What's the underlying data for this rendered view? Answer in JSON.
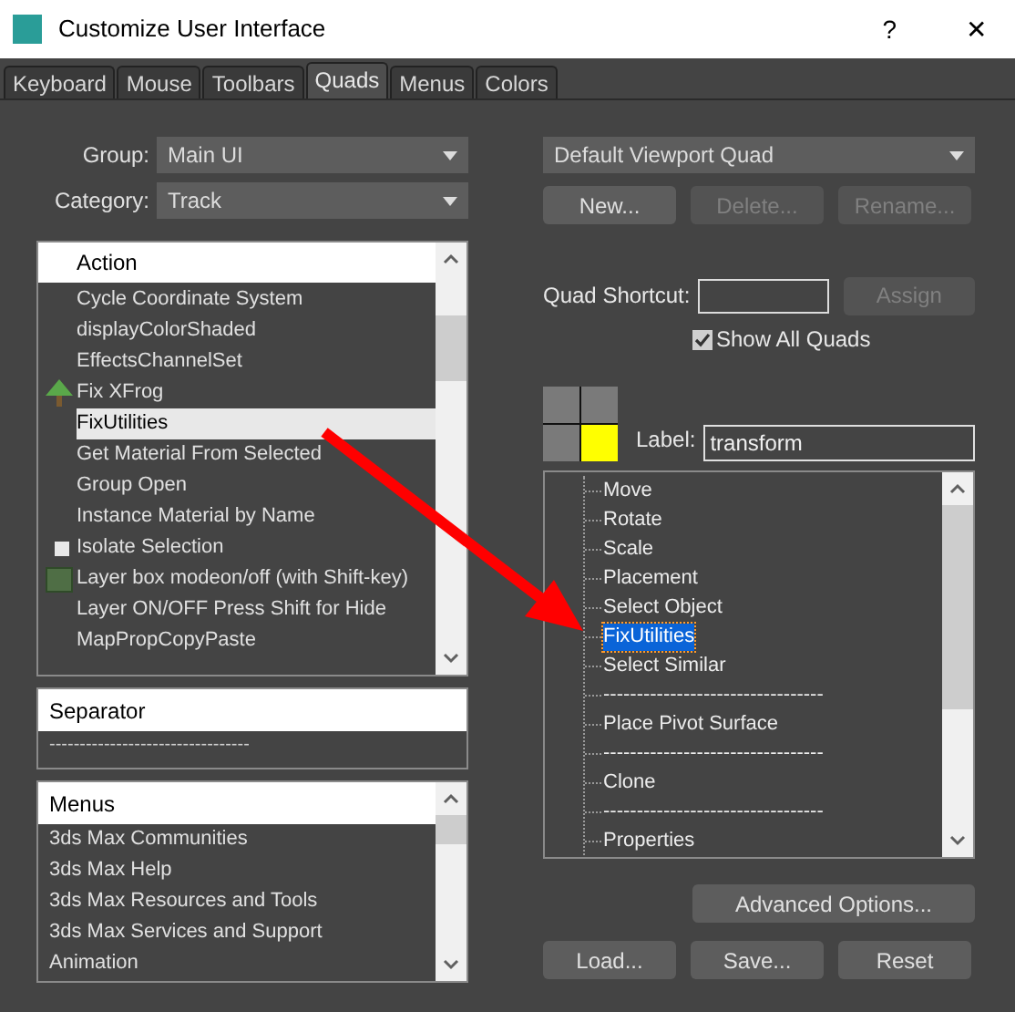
{
  "window": {
    "title": "Customize User Interface",
    "help": "?",
    "close": "✕"
  },
  "tabs": [
    {
      "label": "Keyboard",
      "selected": false
    },
    {
      "label": "Mouse",
      "selected": false
    },
    {
      "label": "Toolbars",
      "selected": false
    },
    {
      "label": "Quads",
      "selected": true
    },
    {
      "label": "Menus",
      "selected": false
    },
    {
      "label": "Colors",
      "selected": false
    }
  ],
  "group": {
    "label": "Group:",
    "value": "Main UI"
  },
  "category": {
    "label": "Category:",
    "value": "Track"
  },
  "actions_list": {
    "header": "Action",
    "items": [
      {
        "label": "Cycle Coordinate System",
        "kind": "plain",
        "selected": false
      },
      {
        "label": "displayColorShaded",
        "kind": "plain",
        "selected": false
      },
      {
        "label": "EffectsChannelSet",
        "kind": "plain",
        "selected": false
      },
      {
        "label": "Fix XFrog",
        "kind": "tree",
        "selected": false
      },
      {
        "label": "FixUtilities",
        "kind": "plain",
        "selected": true
      },
      {
        "label": "Get Material From Selected",
        "kind": "plain",
        "selected": false
      },
      {
        "label": "Group Open",
        "kind": "plain",
        "selected": false
      },
      {
        "label": "Instance Material by Name",
        "kind": "plain",
        "selected": false
      },
      {
        "label": "Isolate Selection",
        "kind": "cube",
        "selected": false
      },
      {
        "label": "Layer box modeon/off (with Shift-key)",
        "kind": "box",
        "selected": false
      },
      {
        "label": "Layer ON/OFF Press Shift for Hide",
        "kind": "plain",
        "selected": false
      },
      {
        "label": "MapPropCopyPaste",
        "kind": "plain",
        "selected": false
      }
    ]
  },
  "separator_list": {
    "header": "Separator",
    "items": [
      "---------------------------------"
    ]
  },
  "menus_list": {
    "header": "Menus",
    "items": [
      "3ds Max Communities",
      "3ds Max Help",
      "3ds Max Resources and Tools",
      "3ds Max Services and Support",
      "Animation"
    ]
  },
  "quad_set": {
    "value": "Default Viewport Quad"
  },
  "quad_buttons": [
    {
      "label": "New...",
      "disabled": false
    },
    {
      "label": "Delete...",
      "disabled": true
    },
    {
      "label": "Rename...",
      "disabled": true
    }
  ],
  "quad_shortcut": {
    "label": "Quad Shortcut:",
    "button": "Assign",
    "button_disabled": true
  },
  "show_all_quads": {
    "label": "Show All Quads",
    "checked": true
  },
  "quad_preview": [
    {
      "selected": false
    },
    {
      "selected": false
    },
    {
      "selected": false
    },
    {
      "selected": true
    }
  ],
  "quad_label": {
    "label": "Label:",
    "value": "transform"
  },
  "quad_items": [
    {
      "label": "Move",
      "selected": false
    },
    {
      "label": "Rotate",
      "selected": false
    },
    {
      "label": "Scale",
      "selected": false
    },
    {
      "label": "Placement",
      "selected": false
    },
    {
      "label": "Select Object",
      "selected": false
    },
    {
      "label": "FixUtilities",
      "selected": true
    },
    {
      "label": "Select Similar",
      "selected": false
    },
    {
      "label": "---------------------------------",
      "selected": false
    },
    {
      "label": "Place Pivot Surface",
      "selected": false
    },
    {
      "label": "---------------------------------",
      "selected": false
    },
    {
      "label": "Clone",
      "selected": false
    },
    {
      "label": "---------------------------------",
      "selected": false
    },
    {
      "label": "Properties",
      "selected": false
    }
  ],
  "advanced_button": "Advanced Options...",
  "bottom_buttons": [
    "Load...",
    "Save...",
    "Reset"
  ]
}
